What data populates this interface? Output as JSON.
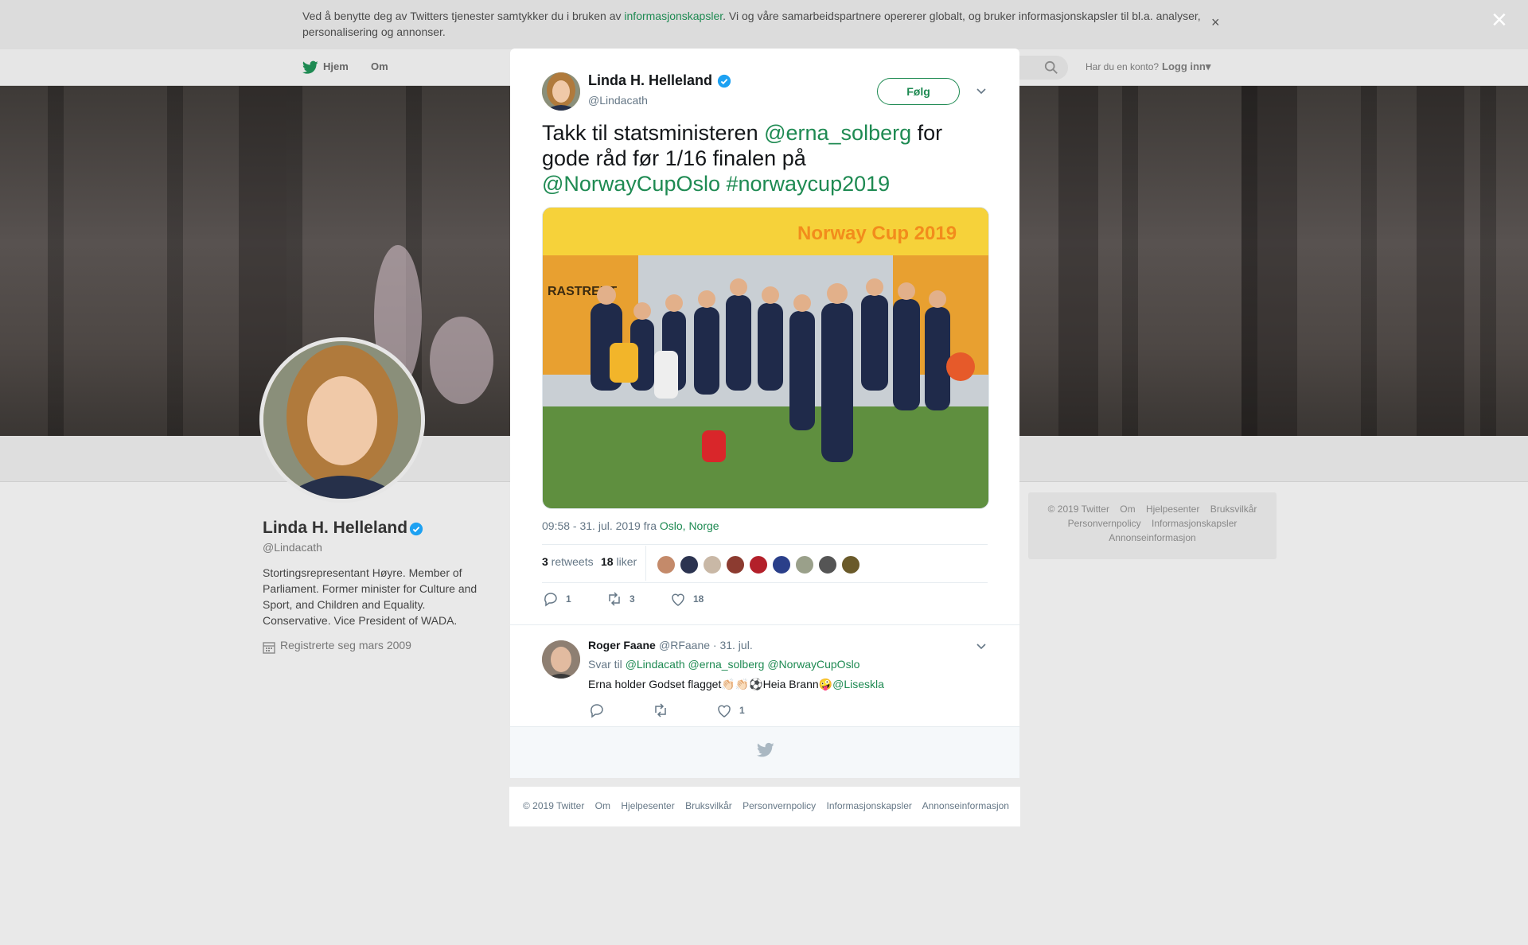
{
  "cookie_banner": {
    "text_before": "Ved å benytte deg av Twitters tjenester samtykker du i bruken av ",
    "link": "informasjonskapsler",
    "text_after": ". Vi og våre samarbeidspartnere opererer globalt, og bruker informasjonskapsler til bl.a. analyser, personalisering og annonser.",
    "close_icon": "×"
  },
  "page_close_icon": "×",
  "nav": {
    "home": "Hjem",
    "about": "Om",
    "account_prompt": "Har du en konto?",
    "login": "Logg inn",
    "login_caret": "▾"
  },
  "profile": {
    "name": "Linda H. Helleland",
    "handle": "@Lindacath",
    "bio": "Stortingsrepresentant Høyre. Member of Parliament. Former minister for Culture and Sport, and Children and Equality. Conservative. Vice President of WADA.",
    "joined": "Registrerte seg mars 2009"
  },
  "side_footer": {
    "row1": [
      "© 2019 Twitter",
      "Om",
      "Hjelpesenter",
      "Bruksvilkår"
    ],
    "row2": [
      "Personvernpolicy",
      "Informasjonskapsler"
    ],
    "row3": [
      "Annonseinformasjon"
    ]
  },
  "tweet": {
    "name": "Linda H. Helleland",
    "handle": "@Lindacath",
    "follow_label": "Følg",
    "text_1": "Takk til statsministeren ",
    "mention_1": "@erna_solberg",
    "text_2": " for gode råd før 1/16 finalen på ",
    "mention_2": "@NorwayCupOslo",
    "text_3": " ",
    "hashtag": "#norwaycup2019",
    "photo_banner_text": "Norway Cup 2019",
    "photo_sign_text": "RASTRENT",
    "timestamp": "09:58 - 31. jul. 2019 fra ",
    "location": "Oslo, Norge",
    "retweets_count": "3",
    "retweets_label": " retweets",
    "likes_count": "18",
    "likes_label": " liker",
    "actions": {
      "replies": "1",
      "retweets": "3",
      "likes": "18"
    }
  },
  "reply": {
    "name": "Roger Faane",
    "handle_date": "@RFaane · 31. jul.",
    "reply_to_label": "Svar til ",
    "reply_to_mentions": "@Lindacath @erna_solberg @NorwayCupOslo",
    "text": "Erna holder Godset flagget👏🏻👏🏻⚽️Heia Brann🤪",
    "mention": "@Liseskla",
    "actions": {
      "likes": "1"
    }
  },
  "bottom_footer": [
    "© 2019 Twitter",
    "Om",
    "Hjelpesenter",
    "Bruksvilkår",
    "Personvernpolicy",
    "Informasjonskapsler",
    "Annonseinformasjon"
  ],
  "colors": {
    "link_green": "#1e8a52",
    "verified_blue": "#1da1f2",
    "muted": "#657786"
  },
  "icons": [
    "twitter-bird-icon",
    "search-icon",
    "verified-badge-icon",
    "calendar-icon",
    "chevron-down-icon",
    "reply-icon",
    "retweet-icon",
    "heart-icon",
    "close-icon"
  ]
}
